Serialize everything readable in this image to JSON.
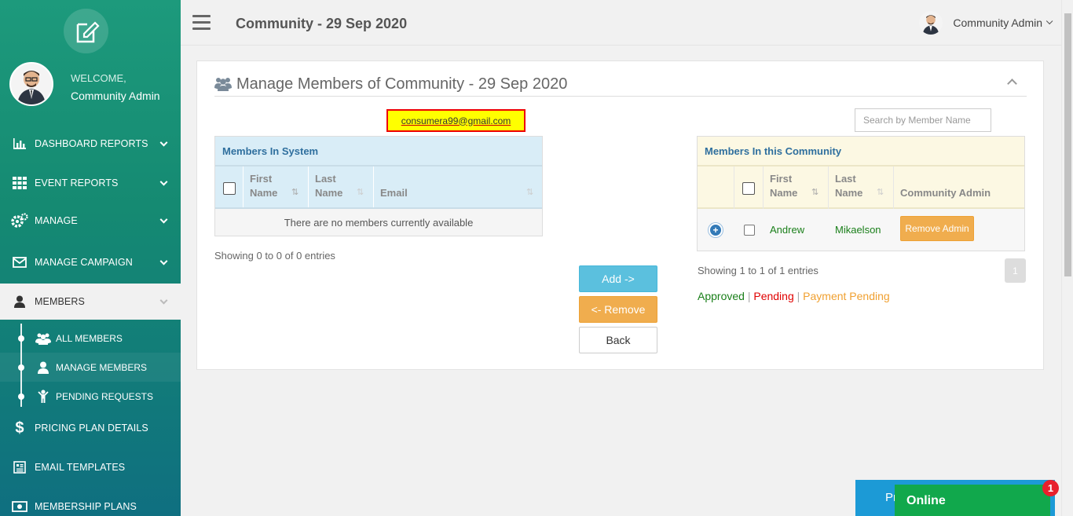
{
  "sidebar": {
    "welcome": "WELCOME,",
    "user_name": "Community Admin",
    "items": [
      {
        "label": "DASHBOARD REPORTS",
        "icon": "bar-chart-icon"
      },
      {
        "label": "EVENT REPORTS",
        "icon": "grid-icon"
      },
      {
        "label": "MANAGE",
        "icon": "gears-icon"
      },
      {
        "label": "MANAGE CAMPAIGN",
        "icon": "envelope-icon"
      },
      {
        "label": "MEMBERS",
        "icon": "user-icon"
      },
      {
        "label": "PRICING PLAN DETAILS",
        "icon": "dollar-icon"
      },
      {
        "label": "EMAIL TEMPLATES",
        "icon": "newspaper-icon"
      },
      {
        "label": "MEMBERSHIP PLANS",
        "icon": "money-icon"
      }
    ],
    "sub_items": [
      {
        "label": "ALL MEMBERS"
      },
      {
        "label": "MANAGE MEMBERS"
      },
      {
        "label": "PENDING REQUESTS"
      }
    ]
  },
  "header": {
    "title": "Community - 29 Sep 2020",
    "user": "Community Admin"
  },
  "panel": {
    "title": "Manage Members of Community - 29 Sep 2020",
    "highlight_email": "consumera99@gmail.com",
    "search_placeholder": "Search by Member Name"
  },
  "system_table": {
    "caption": "Members In System",
    "headers": [
      "First\nName",
      "Last\nName",
      "Email"
    ],
    "empty": "There are no members currently available",
    "info": "Showing 0 to 0 of 0 entries"
  },
  "community_table": {
    "caption": "Members In this Community",
    "headers": [
      "First\nName",
      "Last\nName",
      "Community Admin"
    ],
    "rows": [
      {
        "first": "Andrew",
        "last": "Mikaelson",
        "action": "Remove Admin"
      }
    ],
    "info": "Showing 1 to 1 of 1 entries",
    "page": "1"
  },
  "actions": {
    "add": "Add ->",
    "remove": "<- Remove",
    "back": "Back"
  },
  "legend": {
    "approved": "Approved",
    "sep": "|",
    "pending": "Pending",
    "payment_pending": "Payment Pending"
  },
  "widgets": {
    "bottom_blue": "Pr",
    "online": "Online",
    "badge": "1"
  },
  "colors": {
    "approved": "#1a7f1a",
    "pending": "#e00000",
    "payment_pending": "#f0a030",
    "accent": "#158a72"
  }
}
